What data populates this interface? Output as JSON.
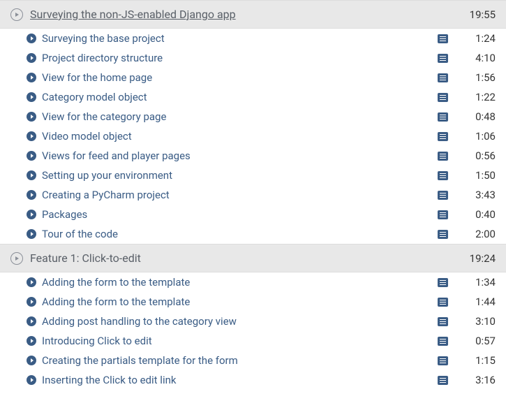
{
  "sections": [
    {
      "title": "Surveying the non-JS-enabled Django app",
      "underlined": true,
      "duration": "19:55",
      "lessons": [
        {
          "title": "Surveying the base project",
          "duration": "1:24"
        },
        {
          "title": "Project directory structure",
          "duration": "4:10"
        },
        {
          "title": "View for the home page",
          "duration": "1:56"
        },
        {
          "title": "Category model object",
          "duration": "1:22"
        },
        {
          "title": "View for the category page",
          "duration": "0:48"
        },
        {
          "title": "Video model object",
          "duration": "1:06"
        },
        {
          "title": "Views for feed and player pages",
          "duration": "0:56"
        },
        {
          "title": "Setting up your environment",
          "duration": "1:50"
        },
        {
          "title": "Creating a PyCharm project",
          "duration": "3:43"
        },
        {
          "title": "Packages",
          "duration": "0:40"
        },
        {
          "title": "Tour of the code",
          "duration": "2:00"
        }
      ]
    },
    {
      "title": "Feature 1: Click-to-edit",
      "underlined": false,
      "duration": "19:24",
      "lessons": [
        {
          "title": "Adding the form to the template",
          "duration": "1:34"
        },
        {
          "title": "Adding the form to the template",
          "duration": "1:44"
        },
        {
          "title": "Adding post handling to the category view",
          "duration": "3:10"
        },
        {
          "title": "Introducing Click to edit",
          "duration": "0:57"
        },
        {
          "title": "Creating the partials template for the form",
          "duration": "1:15"
        },
        {
          "title": "Inserting the Click to edit link",
          "duration": "3:16"
        }
      ]
    }
  ]
}
